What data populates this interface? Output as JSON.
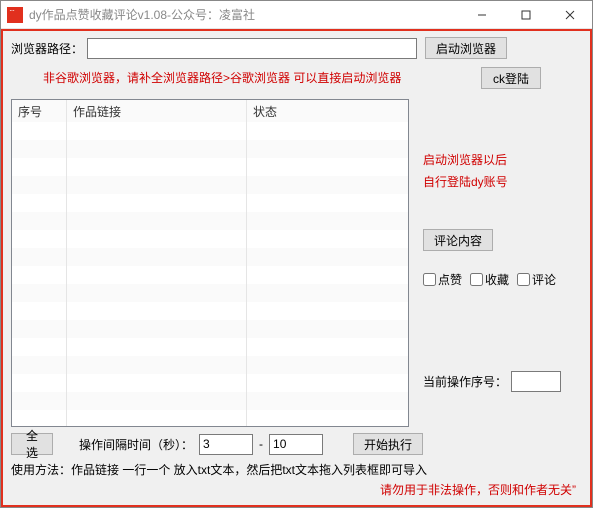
{
  "title": "dy作品点赞收藏评论v1.08-公众号：凌富社",
  "pathLabel": "浏览器路径：",
  "pathValue": "",
  "launchBtn": "启动浏览器",
  "hint": "非谷歌浏览器，请补全浏览器路径>谷歌浏览器 可以直接启动浏览器",
  "ckLoginBtn": "ck登陆",
  "table": {
    "headers": [
      "序号",
      "作品链接",
      "状态"
    ]
  },
  "side1": "启动浏览器以后",
  "side2": "自行登陆dy账号",
  "commentBtn": "评论内容",
  "checks": {
    "like": "点赞",
    "collect": "收藏",
    "comment": "评论"
  },
  "curOpLabel": "当前操作序号：",
  "curOpValue": "",
  "selectAllBtn": "全选",
  "intervalLabel": "操作间隔时间（秒）：",
  "intervalFrom": "3",
  "intervalDash": "-",
  "intervalTo": "10",
  "startBtn": "开始执行",
  "usage": "使用方法：作品链接 一行一个 放入txt文本，然后把txt文本拖入列表框即可导入",
  "warning": "请勿用于非法操作，否则和作者无关”"
}
